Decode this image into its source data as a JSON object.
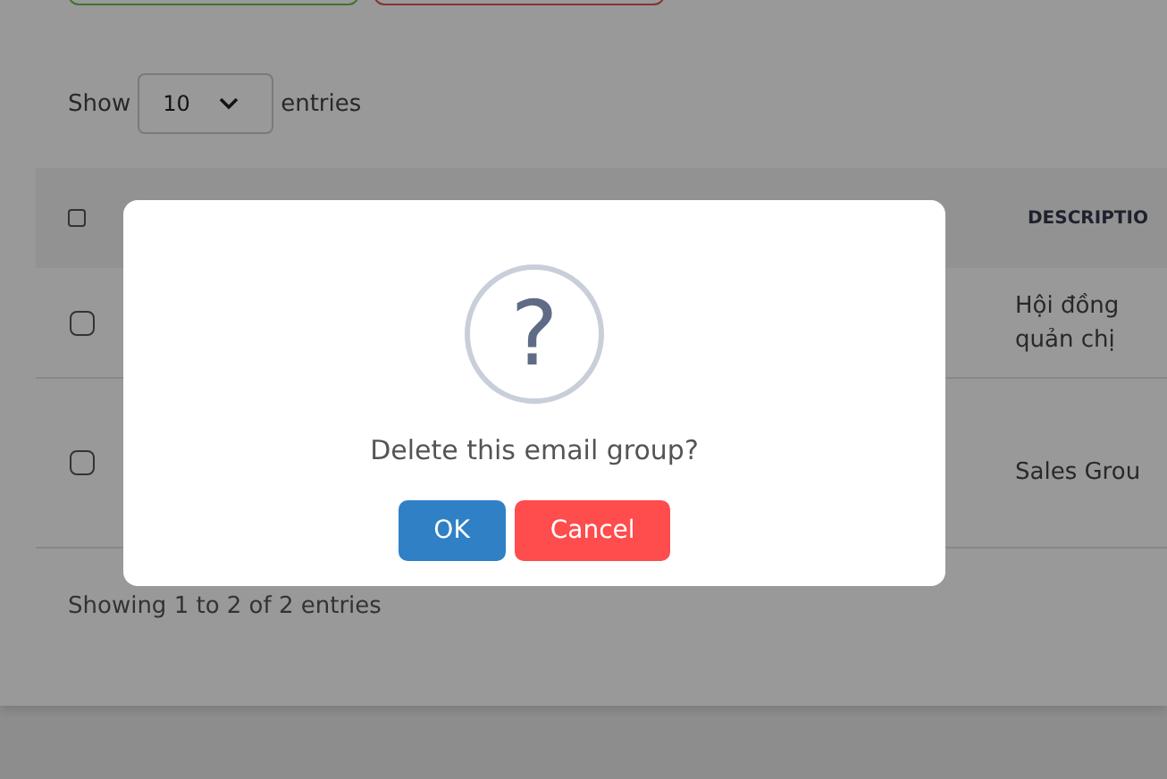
{
  "top_buttons": [
    {
      "kind": "success"
    },
    {
      "kind": "danger"
    }
  ],
  "length_menu": {
    "before": "Show",
    "value": "10",
    "after": "entries"
  },
  "table": {
    "select_all": {
      "checked": false
    },
    "columns": [
      "DESCRIPTIO"
    ],
    "rows": [
      {
        "checked": false,
        "description": "Hội đồng quản chị"
      },
      {
        "checked": false,
        "description": "Sales Grou"
      }
    ]
  },
  "info": "Showing 1 to 2 of 2 entries",
  "dialog": {
    "icon": "?",
    "message": "Delete this email group?",
    "buttons": [
      {
        "label": "OK",
        "kind": "confirm"
      },
      {
        "label": "Cancel",
        "kind": "cancel"
      }
    ]
  }
}
